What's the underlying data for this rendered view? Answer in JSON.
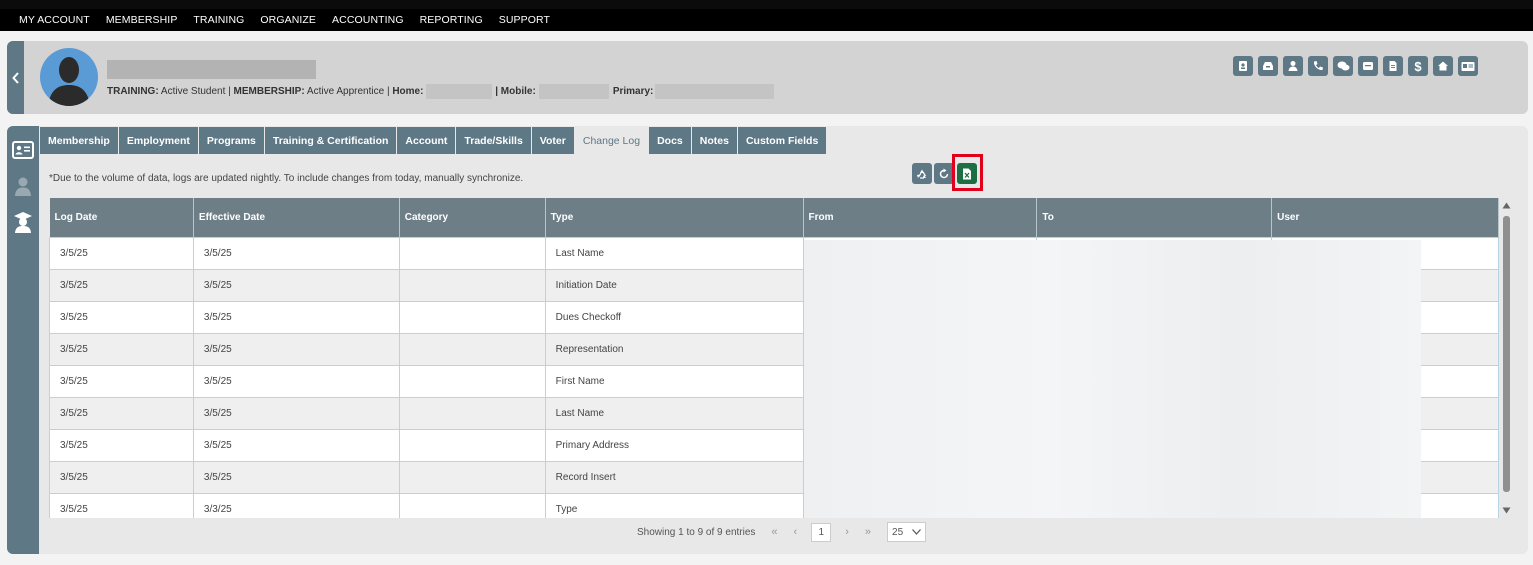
{
  "topnav": [
    "MY ACCOUNT",
    "MEMBERSHIP",
    "TRAINING",
    "ORGANIZE",
    "ACCOUNTING",
    "REPORTING",
    "SUPPORT"
  ],
  "profile": {
    "training_label": "TRAINING:",
    "training_value": " Active Student | ",
    "membership_label": "MEMBERSHIP:",
    "membership_value": " Active Apprentice | ",
    "home_label": "Home:",
    "mobile_label": " | Mobile:",
    "primary_label": "Primary:"
  },
  "header_icons": [
    "id-badge-icon",
    "inbox-icon",
    "person-icon",
    "phone-icon",
    "chat-icon",
    "archive-icon",
    "document-icon",
    "dollar-icon",
    "home-icon",
    "id-card-icon"
  ],
  "tabs": [
    "Membership",
    "Employment",
    "Programs",
    "Training & Certification",
    "Account",
    "Trade/Skills",
    "Voter",
    "Change Log",
    "Docs",
    "Notes",
    "Custom Fields"
  ],
  "active_tab": "Change Log",
  "notice": "*Due to the volume of data, logs are updated nightly. To include changes from today, manually synchronize.",
  "columns": [
    "Log Date",
    "Effective Date",
    "Category",
    "Type",
    "From",
    "To",
    "User"
  ],
  "rows": [
    [
      "3/5/25",
      "3/5/25",
      "",
      "Last Name"
    ],
    [
      "3/5/25",
      "3/5/25",
      "",
      "Initiation Date"
    ],
    [
      "3/5/25",
      "3/5/25",
      "",
      "Dues Checkoff"
    ],
    [
      "3/5/25",
      "3/5/25",
      "",
      "Representation"
    ],
    [
      "3/5/25",
      "3/5/25",
      "",
      "First Name"
    ],
    [
      "3/5/25",
      "3/5/25",
      "",
      "Last Name"
    ],
    [
      "3/5/25",
      "3/5/25",
      "",
      "Primary Address"
    ],
    [
      "3/5/25",
      "3/5/25",
      "",
      "Record Insert"
    ],
    [
      "3/5/25",
      "3/3/25",
      "",
      "Type"
    ]
  ],
  "pager": {
    "info": "Showing 1 to 9 of 9 entries",
    "first": "«",
    "prev": "‹",
    "current": "1",
    "next": "›",
    "last": "»",
    "page_size": "25"
  },
  "colors": {
    "nav_bg": "#000000",
    "accent": "#5e7886",
    "export_button": "#1d6f42",
    "highlight": "#e0001b"
  }
}
